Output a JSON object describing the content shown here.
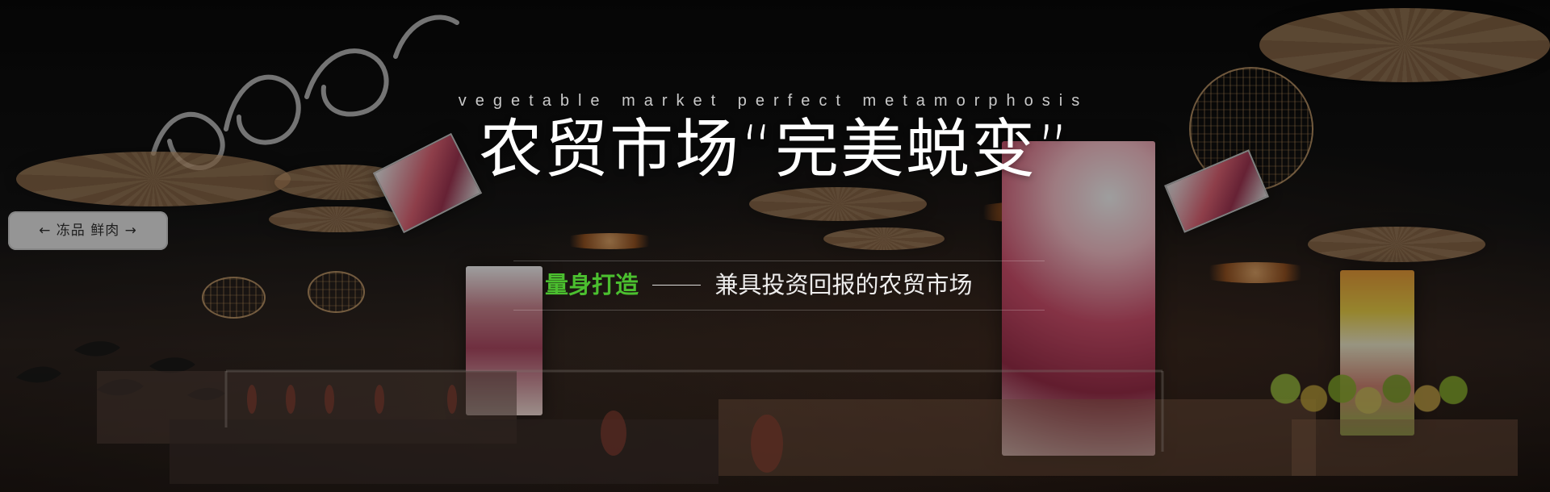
{
  "banner": {
    "subtitle_en": "vegetable market perfect metamorphosis",
    "headline": "农贸市场“完美蜕变”",
    "tagline_accent": "量身打造",
    "tagline_rest": "兼具投资回报的农贸市场"
  },
  "signage": {
    "left_sign": "← 冻品 鲜肉 →"
  }
}
